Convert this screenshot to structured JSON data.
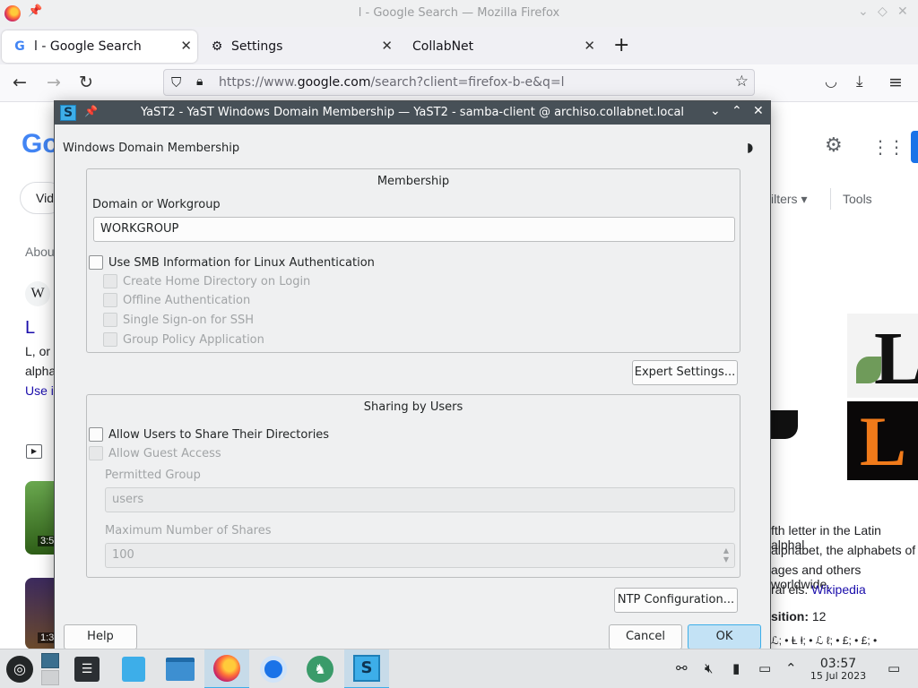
{
  "browser": {
    "window_title": "l - Google Search — Mozilla Firefox",
    "tabs": [
      {
        "label": "l - Google Search"
      },
      {
        "label": "Settings"
      },
      {
        "label": "CollabNet"
      }
    ],
    "url_prefix": "https://www.",
    "url_host": "google.com",
    "url_rest": "/search?client=firefox-b-e&q=l"
  },
  "google": {
    "logo_partial": "Go",
    "chip_partial": "Vid",
    "about_partial": "Abou",
    "wiki_glyph": "W",
    "result_title": "L",
    "result_line1": "L, or",
    "result_line2": "alpha",
    "result_line3": "Use i",
    "filters_label": "ilters",
    "tools_label": "Tools",
    "kp_line1": "fth letter in the Latin alphal",
    "kp_line2": "alphabet, the alphabets of",
    "kp_line3": "ages and others worldwide.",
    "kp_line4_text": "ral els.",
    "kp_line4_link": "Wikipedia",
    "kp_position_label": "sition:",
    "kp_position_value": "12",
    "kp_symbols": "ℒ; • Ⱡ ⱡ; • ℒ ℓ; • £; • £; •",
    "video1_duration": "3:5",
    "video2_duration": "1:3"
  },
  "dialog": {
    "title": "YaST2 - YaST Windows Domain Membership — YaST2 - samba-client @ archiso.collabnet.local",
    "heading": "Windows Domain Membership",
    "membership": {
      "title": "Membership",
      "domain_label": "Domain or Workgroup",
      "domain_value": "WORKGROUP",
      "use_smb_label": "Use SMB Information for Linux Authentication",
      "sub_options": [
        "Create Home Directory on Login",
        "Offline Authentication",
        "Single Sign-on for SSH",
        "Group Policy Application"
      ]
    },
    "expert_button": "Expert Settings...",
    "sharing": {
      "title": "Sharing by Users",
      "allow_share_label": "Allow Users to Share Their Directories",
      "allow_guest_label": "Allow Guest Access",
      "permitted_group_label": "Permitted Group",
      "permitted_group_value": "users",
      "max_shares_label": "Maximum Number of Shares",
      "max_shares_value": "100"
    },
    "ntp_button": "NTP Configuration...",
    "help_button": "Help",
    "cancel_button": "Cancel",
    "ok_button": "OK"
  },
  "taskbar": {
    "time": "03:57",
    "date": "15 Jul 2023"
  },
  "colors": {
    "accent": "#3daee9",
    "titlebar": "#475057",
    "google_link": "#1a0dab"
  }
}
